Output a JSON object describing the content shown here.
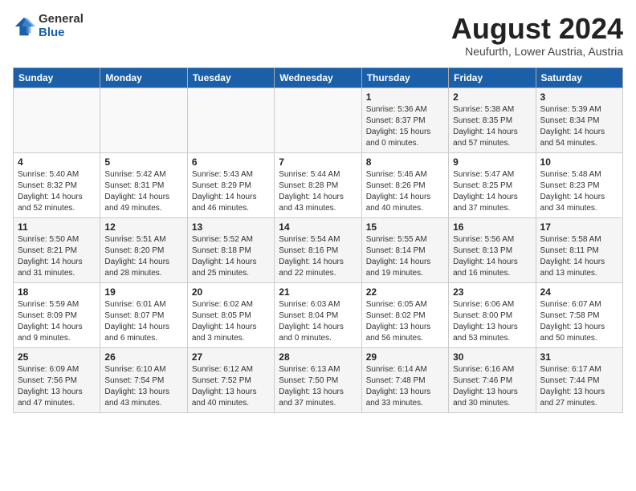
{
  "logo": {
    "general": "General",
    "blue": "Blue"
  },
  "header": {
    "month": "August 2024",
    "location": "Neufurth, Lower Austria, Austria"
  },
  "days_of_week": [
    "Sunday",
    "Monday",
    "Tuesday",
    "Wednesday",
    "Thursday",
    "Friday",
    "Saturday"
  ],
  "weeks": [
    [
      {
        "day": "",
        "info": ""
      },
      {
        "day": "",
        "info": ""
      },
      {
        "day": "",
        "info": ""
      },
      {
        "day": "",
        "info": ""
      },
      {
        "day": "1",
        "info": "Sunrise: 5:36 AM\nSunset: 8:37 PM\nDaylight: 15 hours\nand 0 minutes."
      },
      {
        "day": "2",
        "info": "Sunrise: 5:38 AM\nSunset: 8:35 PM\nDaylight: 14 hours\nand 57 minutes."
      },
      {
        "day": "3",
        "info": "Sunrise: 5:39 AM\nSunset: 8:34 PM\nDaylight: 14 hours\nand 54 minutes."
      }
    ],
    [
      {
        "day": "4",
        "info": "Sunrise: 5:40 AM\nSunset: 8:32 PM\nDaylight: 14 hours\nand 52 minutes."
      },
      {
        "day": "5",
        "info": "Sunrise: 5:42 AM\nSunset: 8:31 PM\nDaylight: 14 hours\nand 49 minutes."
      },
      {
        "day": "6",
        "info": "Sunrise: 5:43 AM\nSunset: 8:29 PM\nDaylight: 14 hours\nand 46 minutes."
      },
      {
        "day": "7",
        "info": "Sunrise: 5:44 AM\nSunset: 8:28 PM\nDaylight: 14 hours\nand 43 minutes."
      },
      {
        "day": "8",
        "info": "Sunrise: 5:46 AM\nSunset: 8:26 PM\nDaylight: 14 hours\nand 40 minutes."
      },
      {
        "day": "9",
        "info": "Sunrise: 5:47 AM\nSunset: 8:25 PM\nDaylight: 14 hours\nand 37 minutes."
      },
      {
        "day": "10",
        "info": "Sunrise: 5:48 AM\nSunset: 8:23 PM\nDaylight: 14 hours\nand 34 minutes."
      }
    ],
    [
      {
        "day": "11",
        "info": "Sunrise: 5:50 AM\nSunset: 8:21 PM\nDaylight: 14 hours\nand 31 minutes."
      },
      {
        "day": "12",
        "info": "Sunrise: 5:51 AM\nSunset: 8:20 PM\nDaylight: 14 hours\nand 28 minutes."
      },
      {
        "day": "13",
        "info": "Sunrise: 5:52 AM\nSunset: 8:18 PM\nDaylight: 14 hours\nand 25 minutes."
      },
      {
        "day": "14",
        "info": "Sunrise: 5:54 AM\nSunset: 8:16 PM\nDaylight: 14 hours\nand 22 minutes."
      },
      {
        "day": "15",
        "info": "Sunrise: 5:55 AM\nSunset: 8:14 PM\nDaylight: 14 hours\nand 19 minutes."
      },
      {
        "day": "16",
        "info": "Sunrise: 5:56 AM\nSunset: 8:13 PM\nDaylight: 14 hours\nand 16 minutes."
      },
      {
        "day": "17",
        "info": "Sunrise: 5:58 AM\nSunset: 8:11 PM\nDaylight: 14 hours\nand 13 minutes."
      }
    ],
    [
      {
        "day": "18",
        "info": "Sunrise: 5:59 AM\nSunset: 8:09 PM\nDaylight: 14 hours\nand 9 minutes."
      },
      {
        "day": "19",
        "info": "Sunrise: 6:01 AM\nSunset: 8:07 PM\nDaylight: 14 hours\nand 6 minutes."
      },
      {
        "day": "20",
        "info": "Sunrise: 6:02 AM\nSunset: 8:05 PM\nDaylight: 14 hours\nand 3 minutes."
      },
      {
        "day": "21",
        "info": "Sunrise: 6:03 AM\nSunset: 8:04 PM\nDaylight: 14 hours\nand 0 minutes."
      },
      {
        "day": "22",
        "info": "Sunrise: 6:05 AM\nSunset: 8:02 PM\nDaylight: 13 hours\nand 56 minutes."
      },
      {
        "day": "23",
        "info": "Sunrise: 6:06 AM\nSunset: 8:00 PM\nDaylight: 13 hours\nand 53 minutes."
      },
      {
        "day": "24",
        "info": "Sunrise: 6:07 AM\nSunset: 7:58 PM\nDaylight: 13 hours\nand 50 minutes."
      }
    ],
    [
      {
        "day": "25",
        "info": "Sunrise: 6:09 AM\nSunset: 7:56 PM\nDaylight: 13 hours\nand 47 minutes."
      },
      {
        "day": "26",
        "info": "Sunrise: 6:10 AM\nSunset: 7:54 PM\nDaylight: 13 hours\nand 43 minutes."
      },
      {
        "day": "27",
        "info": "Sunrise: 6:12 AM\nSunset: 7:52 PM\nDaylight: 13 hours\nand 40 minutes."
      },
      {
        "day": "28",
        "info": "Sunrise: 6:13 AM\nSunset: 7:50 PM\nDaylight: 13 hours\nand 37 minutes."
      },
      {
        "day": "29",
        "info": "Sunrise: 6:14 AM\nSunset: 7:48 PM\nDaylight: 13 hours\nand 33 minutes."
      },
      {
        "day": "30",
        "info": "Sunrise: 6:16 AM\nSunset: 7:46 PM\nDaylight: 13 hours\nand 30 minutes."
      },
      {
        "day": "31",
        "info": "Sunrise: 6:17 AM\nSunset: 7:44 PM\nDaylight: 13 hours\nand 27 minutes."
      }
    ]
  ]
}
